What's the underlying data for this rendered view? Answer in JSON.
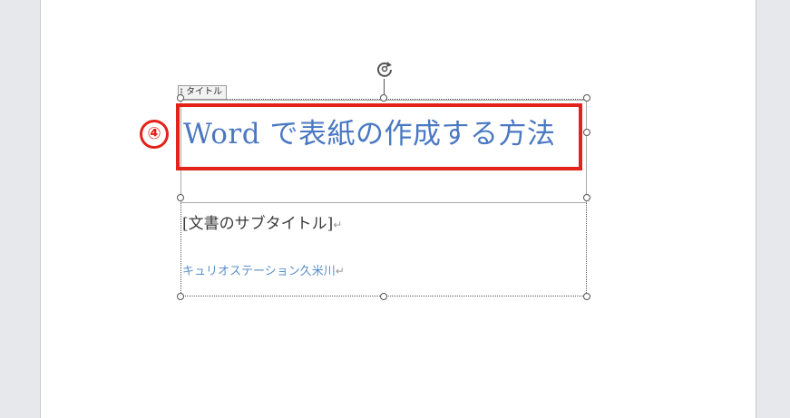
{
  "document": {
    "content_control_tag": "タイトル",
    "title": "Word で表紙の作成する方法",
    "subtitle": "[文書のサブタイトル]",
    "author": "キュリオステーション久米川",
    "paragraph_mark": "↵"
  },
  "annotation": {
    "step_number": "④",
    "highlight_color": "#e2231a"
  },
  "icons": {
    "rotate": "rotate-handle-icon",
    "resize": "resize-handle-icon"
  },
  "colors": {
    "title_text": "#4a78c2",
    "author_text": "#5b8fc9",
    "subtitle_text": "#3b3b3b",
    "page_background": "#ffffff",
    "workspace_background": "#e6e8ec"
  }
}
